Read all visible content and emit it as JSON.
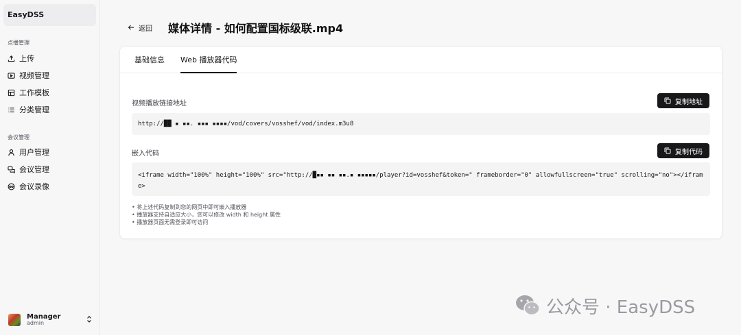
{
  "sidebar": {
    "brand": "EasyDSS",
    "group_vod": "点播管理",
    "vod_items": [
      {
        "label": "上传",
        "icon": "upload-icon"
      },
      {
        "label": "视频管理",
        "icon": "video-icon"
      },
      {
        "label": "工作模板",
        "icon": "template-icon"
      },
      {
        "label": "分类管理",
        "icon": "list-icon"
      }
    ],
    "group_meeting": "会议管理",
    "meeting_items": [
      {
        "label": "用户管理",
        "icon": "user-icon"
      },
      {
        "label": "会议管理",
        "icon": "meeting-icon"
      },
      {
        "label": "会议录像",
        "icon": "recording-icon"
      }
    ],
    "user": {
      "name": "Manager",
      "role": "admin"
    }
  },
  "header": {
    "back_label": "返回",
    "title": "媒体详情 - 如何配置国标级联.mp4"
  },
  "tabs": [
    {
      "label": "基础信息",
      "active": false
    },
    {
      "label": "Web 播放器代码",
      "active": true
    }
  ],
  "play_url": {
    "label": "视频播放链接地址",
    "button": "复制地址",
    "value": "http://██ ▪ ▪▪. ▪▪▪ ▪▪▪▪/vod/covers/vosshef/vod/index.m3u8"
  },
  "embed": {
    "label": "嵌入代码",
    "button": "复制代码",
    "value": "<iframe width=\"100%\" height=\"100%\" src=\"http://█▪▪ ▪▪ ▪▪.▪ ▪▪▪▪▪/player?id=vosshef&token=\" frameborder=\"0\" allowfullscreen=\"true\" scrolling=\"no\"></iframe>"
  },
  "notes": [
    "将上述代码复制到您的网页中即可嵌入播放器",
    "播放器支持自适应大小，您可以修改 width 和 height 属性",
    "播放器页面无需登录即可访问"
  ],
  "watermark": "公众号 · EasyDSS",
  "colors": {
    "accent": "#18181b",
    "background": "#f7f7f8",
    "card": "#ffffff",
    "code_bg": "#f4f4f5"
  }
}
